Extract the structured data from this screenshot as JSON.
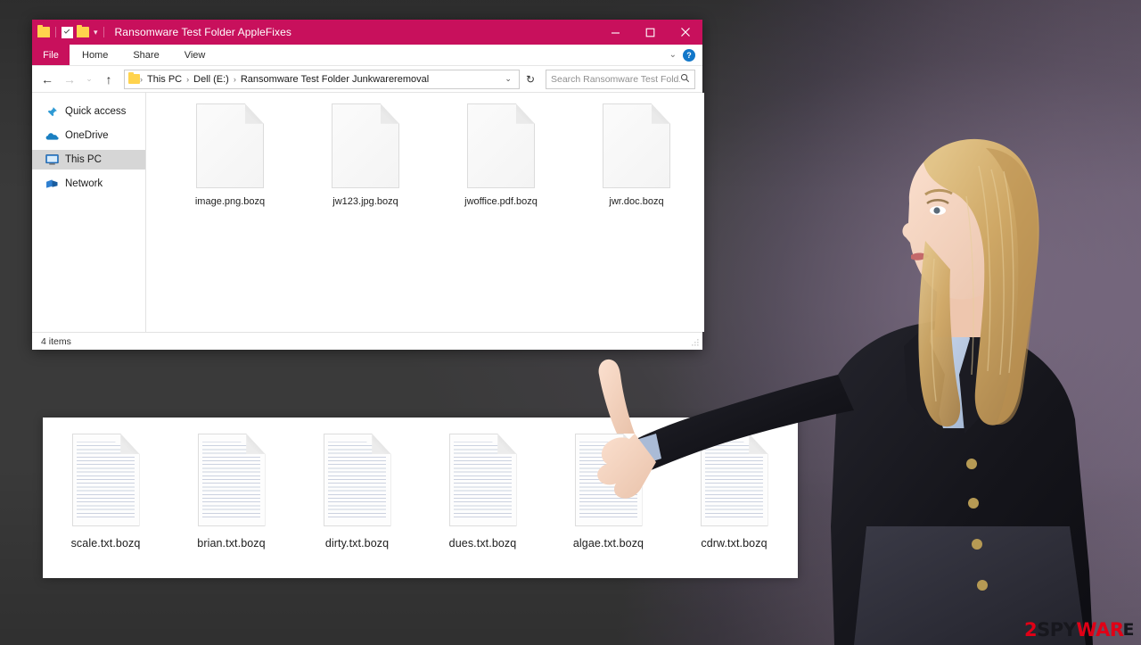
{
  "background": {
    "left_color": "#3a3a3a",
    "right_color": "#75677c"
  },
  "window": {
    "title": "Ransomware Test Folder AppleFixes",
    "accent_color": "#c8105c",
    "quick_access": [
      {
        "name": "folder-icon"
      },
      {
        "name": "properties-checkbox-icon"
      },
      {
        "name": "new-folder-icon"
      },
      {
        "name": "customize-caret-icon",
        "glyph": "▾"
      }
    ],
    "controls": {
      "minimize": "minimize-icon",
      "maximize": "maximize-icon",
      "close": "close-icon"
    },
    "ribbon": {
      "file_tab": "File",
      "tabs": [
        "Home",
        "Share",
        "View"
      ],
      "collapse_glyph": "⌄",
      "help_glyph": "?"
    },
    "nav": {
      "back_glyph": "←",
      "forward_glyph": "→",
      "recent_glyph": "⌄",
      "up_glyph": "↑",
      "refresh_glyph": "↻",
      "dropdown_glyph": "⌄",
      "breadcrumbs": [
        "This PC",
        "Dell (E:)",
        "Ransomware Test Folder Junkwareremoval"
      ],
      "separator": "›"
    },
    "search": {
      "placeholder": "Search Ransomware Test Fold...",
      "icon": "search-icon"
    },
    "sidebar": {
      "items": [
        {
          "label": "Quick access",
          "icon": "pin-icon",
          "selected": false
        },
        {
          "label": "OneDrive",
          "icon": "cloud-icon",
          "selected": false
        },
        {
          "label": "This PC",
          "icon": "monitor-icon",
          "selected": true
        },
        {
          "label": "Network",
          "icon": "network-icon",
          "selected": false
        }
      ]
    },
    "files": [
      {
        "name": "image.png.bozq",
        "icon": "blank-document-icon"
      },
      {
        "name": "jw123.jpg.bozq",
        "icon": "blank-document-icon"
      },
      {
        "name": "jwoffice.pdf.bozq",
        "icon": "blank-document-icon"
      },
      {
        "name": "jwr.doc.bozq",
        "icon": "blank-document-icon"
      }
    ],
    "status": "4 items"
  },
  "bottom_panel": {
    "files": [
      {
        "name": "scale.txt.bozq",
        "icon": "text-document-icon"
      },
      {
        "name": "brian.txt.bozq",
        "icon": "text-document-icon"
      },
      {
        "name": "dirty.txt.bozq",
        "icon": "text-document-icon"
      },
      {
        "name": "dues.txt.bozq",
        "icon": "text-document-icon"
      },
      {
        "name": "algae.txt.bozq",
        "icon": "text-document-icon"
      },
      {
        "name": "cdrw.txt.bozq",
        "icon": "text-document-icon"
      }
    ]
  },
  "presenter": {
    "description": "woman-pointing-photo"
  },
  "logo": {
    "part1": "2",
    "part2": "SPY",
    "part3": "WAR",
    "part4": "E",
    "color_red": "#e00016",
    "color_dark": "#17171d"
  }
}
